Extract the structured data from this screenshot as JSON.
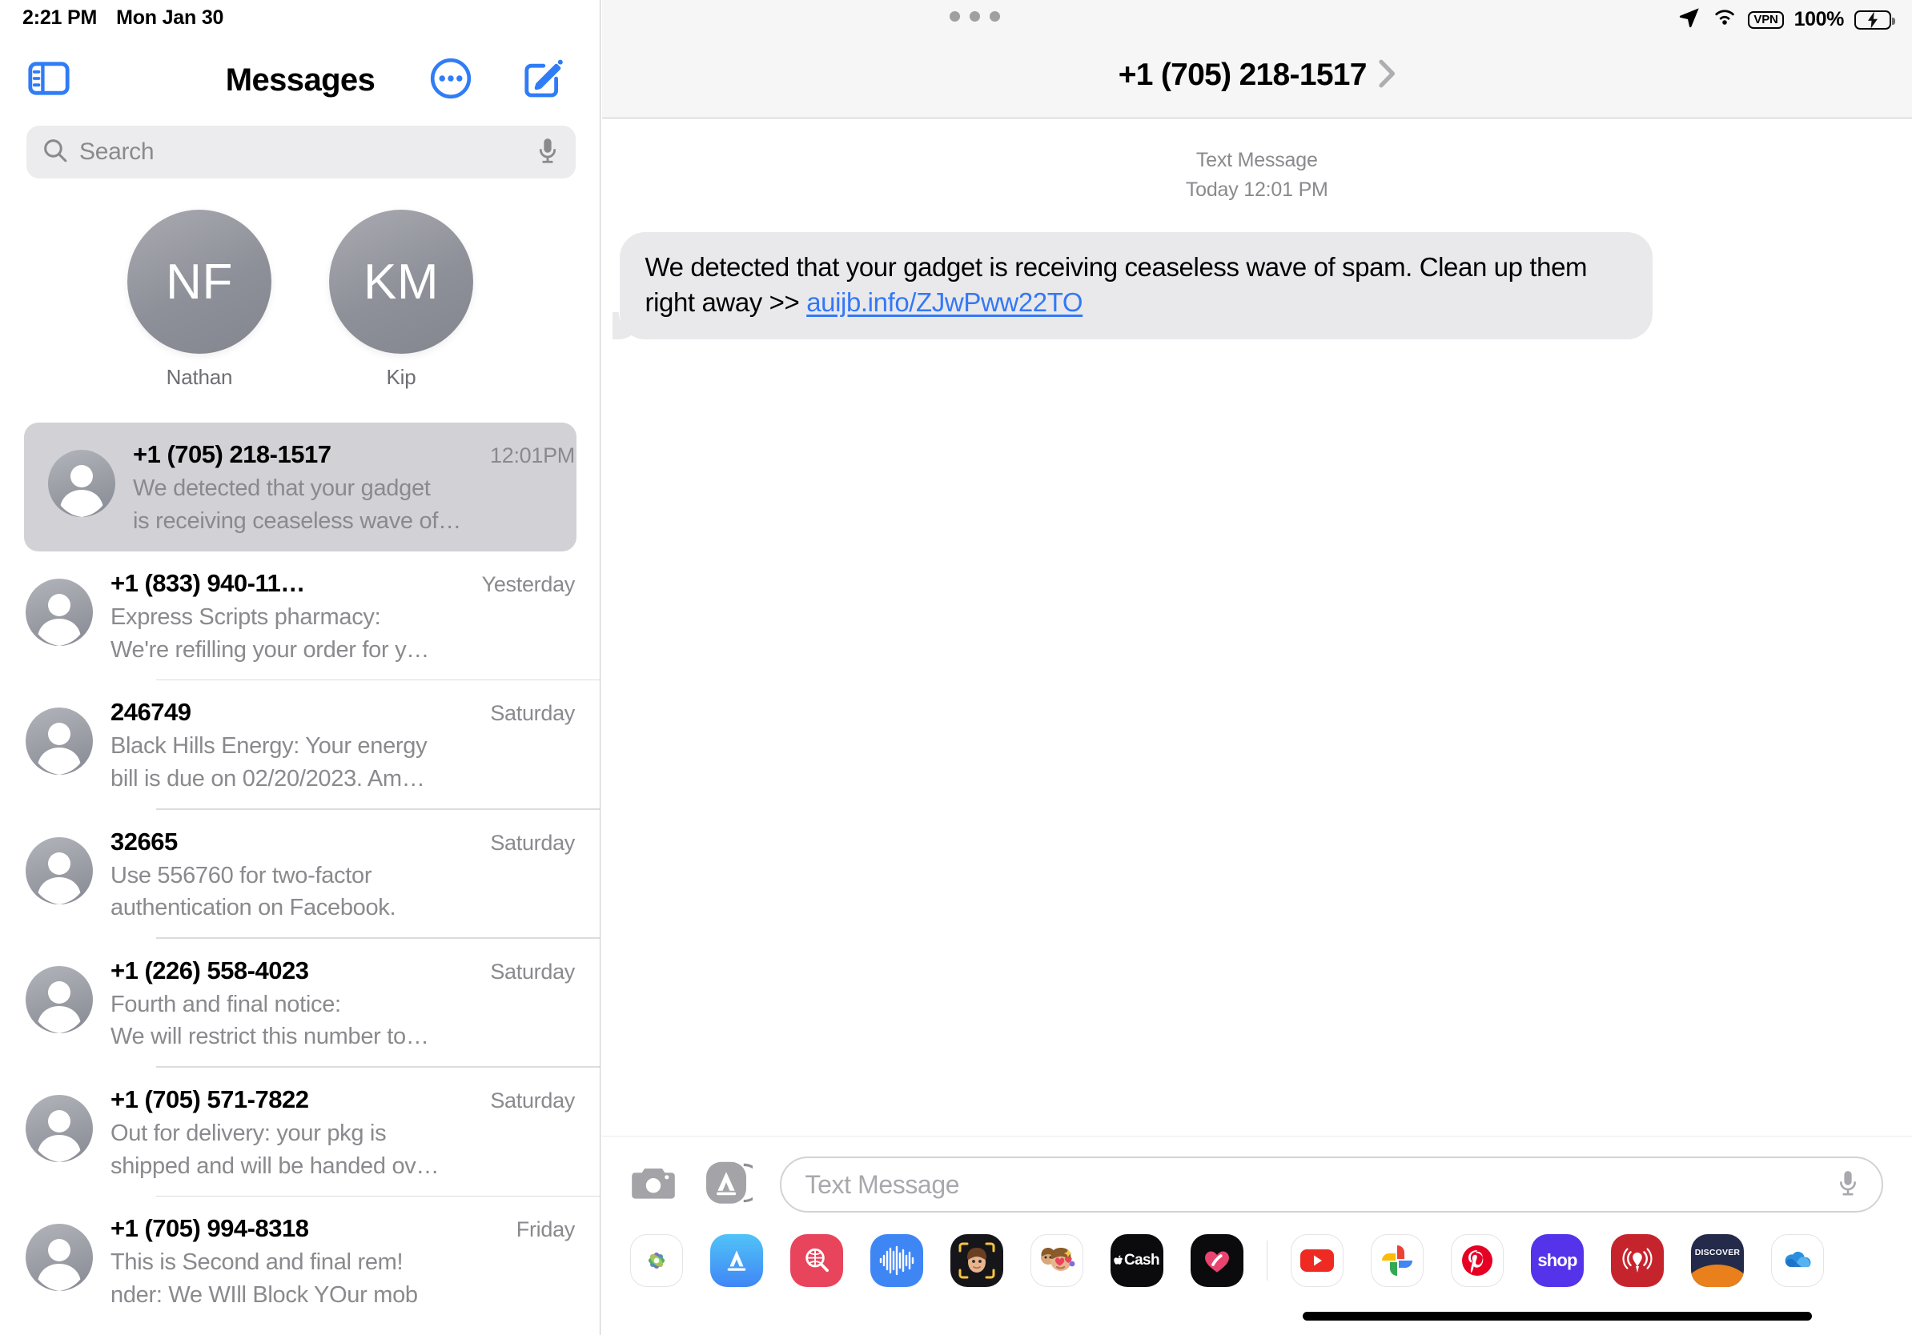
{
  "status_bar": {
    "time": "2:21 PM",
    "date": "Mon Jan 30",
    "battery_percent": "100%",
    "vpn_label": "VPN",
    "icons": [
      "location-arrow-icon",
      "wifi-icon",
      "vpn-badge",
      "battery-charging-icon"
    ],
    "multitask_indicator": "three-dots-handle"
  },
  "sidebar": {
    "title": "Messages",
    "toolbar": {
      "sidebar_toggle": "sidebar-toggle-icon",
      "more": "more-circle-icon",
      "compose": "compose-icon"
    },
    "search": {
      "placeholder": "Search",
      "value": "",
      "mic": "microphone-icon"
    },
    "pinned": [
      {
        "initials": "NF",
        "name": "Nathan"
      },
      {
        "initials": "KM",
        "name": "Kip"
      }
    ],
    "conversations": [
      {
        "name": "+1 (705) 218-1517",
        "time": "12:01PM",
        "preview_line1": "We detected that your gadget",
        "preview_line2": "is receiving ceaseless wave of…",
        "selected": true
      },
      {
        "name": "+1 (833) 940-11…",
        "time": "Yesterday",
        "preview_line1": "Express Scripts pharmacy:",
        "preview_line2": "We're refilling your order for y…",
        "selected": false
      },
      {
        "name": "246749",
        "time": "Saturday",
        "preview_line1": "Black Hills Energy: Your energy",
        "preview_line2": "bill is due on 02/20/2023. Am…",
        "selected": false
      },
      {
        "name": "32665",
        "time": "Saturday",
        "preview_line1": "Use 556760 for two-factor",
        "preview_line2": "authentication on Facebook.",
        "selected": false
      },
      {
        "name": "+1 (226) 558-4023",
        "time": "Saturday",
        "preview_line1": "Fourth and final notice:",
        "preview_line2": "We will restrict this number to…",
        "selected": false
      },
      {
        "name": "+1 (705) 571-7822",
        "time": "Saturday",
        "preview_line1": "Out for delivery: your pkg is",
        "preview_line2": "shipped and will be handed ov…",
        "selected": false
      },
      {
        "name": "+1 (705) 994-8318",
        "time": "Friday",
        "preview_line1": "This is Second and final rem!",
        "preview_line2": "nder: We WIll Block YOur mob",
        "selected": false
      }
    ]
  },
  "chat": {
    "title": "+1 (705) 218-1517",
    "detail_chevron": "chevron-right-icon",
    "message_meta_type": "Text Message",
    "message_meta_time": "Today 12:01 PM",
    "message_text_before_link": "We detected that your gadget is receiving ceaseless wave of spam. Clean up them right away >> ",
    "message_link": "auijb.info/ZJwPww22TO",
    "link_color": "#3478f6",
    "bubble_color": "#e9e9eb"
  },
  "input_bar": {
    "camera": "camera-icon",
    "apps": "app-store-icon",
    "placeholder": "Text Message",
    "value": "",
    "mic": "microphone-icon"
  },
  "app_drawer": {
    "items": [
      {
        "name": "photos-app-icon",
        "label": ""
      },
      {
        "name": "app-store-app-icon",
        "label": ""
      },
      {
        "name": "images-search-app-icon",
        "label": ""
      },
      {
        "name": "voice-memo-app-icon",
        "label": ""
      },
      {
        "name": "memoji-app-icon",
        "label": ""
      },
      {
        "name": "memoji-stickers-app-icon",
        "label": ""
      },
      {
        "name": "apple-cash-app-icon",
        "label": "Cash"
      },
      {
        "name": "digital-touch-app-icon",
        "label": ""
      },
      {
        "name": "youtube-app-icon",
        "label": ""
      },
      {
        "name": "google-photos-app-icon",
        "label": ""
      },
      {
        "name": "pinterest-app-icon",
        "label": ""
      },
      {
        "name": "shop-app-icon",
        "label": "shop"
      },
      {
        "name": "iheartradio-app-icon",
        "label": ""
      },
      {
        "name": "discover-app-icon",
        "label": "DISCOVER"
      },
      {
        "name": "onedrive-app-icon",
        "label": ""
      }
    ]
  }
}
